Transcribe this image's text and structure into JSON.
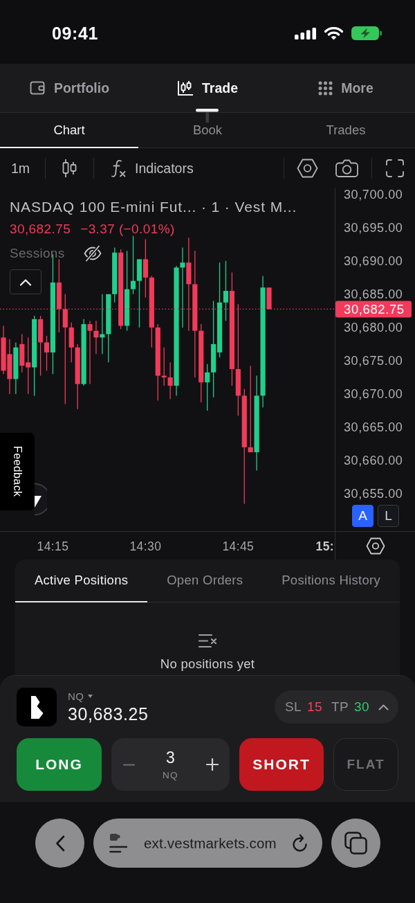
{
  "status_bar": {
    "time": "09:41"
  },
  "nav": {
    "items": [
      {
        "label": "Portfolio",
        "selected": false
      },
      {
        "label": "Trade",
        "selected": true
      },
      {
        "label": "More",
        "selected": false
      }
    ]
  },
  "chart_tabs": [
    {
      "label": "Chart",
      "selected": true
    },
    {
      "label": "Book",
      "selected": false
    },
    {
      "label": "Trades",
      "selected": false
    }
  ],
  "toolbar": {
    "interval": "1m",
    "indicators": "Indicators"
  },
  "chart": {
    "legend": {
      "title": "NASDAQ 100 E-mini Fut... · 1 · Vest M...",
      "price": "30,682.75",
      "change": "−3.37 (−0.01%)",
      "sessions": {
        "label": "Sessions",
        "visible": false
      }
    },
    "scale_buttons": [
      {
        "label": "A",
        "selected": true
      },
      {
        "label": "L",
        "selected": false
      }
    ],
    "edge_time_label": "15:",
    "chart_data": {
      "type": "candlestick",
      "ylim": [
        30649.4,
        30700.9
      ],
      "yticks": [
        {
          "value": 30700,
          "label": "30,700.00"
        },
        {
          "value": 30695,
          "label": "30,695.00"
        },
        {
          "value": 30690,
          "label": "30,690.00"
        },
        {
          "value": 30685,
          "label": "30,685.00"
        },
        {
          "value": 30680,
          "label": "30,680.00"
        },
        {
          "value": 30675,
          "label": "30,675.00"
        },
        {
          "value": 30670,
          "label": "30,670.00"
        },
        {
          "value": 30665,
          "label": "30,665.00"
        },
        {
          "value": 30660,
          "label": "30,660.00"
        },
        {
          "value": 30655,
          "label": "30,655.00"
        }
      ],
      "categories": [
        null,
        null,
        null,
        null,
        null,
        null,
        null,
        null,
        "14:15",
        null,
        null,
        null,
        null,
        null,
        null,
        null,
        null,
        null,
        null,
        null,
        null,
        null,
        null,
        "14:30",
        null,
        null,
        null,
        null,
        null,
        null,
        null,
        null,
        null,
        null,
        null,
        null,
        null,
        null,
        "14:45",
        null,
        null,
        null,
        null,
        null,
        null,
        null,
        null,
        null,
        null,
        null,
        null,
        null,
        null,
        null
      ],
      "series": [
        {
          "ohlc": [
            [
              30678.5,
              30680.25,
              30673,
              30673.5
            ],
            [
              30676,
              30678.25,
              30670,
              30672.25
            ],
            [
              30672.25,
              30677.75,
              30670,
              30677
            ],
            [
              30677.5,
              30679,
              30673.25,
              30674.25
            ],
            [
              30674.75,
              30678.5,
              30670,
              30674
            ],
            [
              30674,
              30681.75,
              30669.75,
              30681.25
            ],
            [
              30681.25,
              30681.75,
              30672.75,
              30677.75
            ],
            [
              30677.75,
              30678.75,
              30673.5,
              30676.25
            ],
            [
              30676.25,
              30691,
              30673,
              30686.75
            ],
            [
              30686.75,
              30690.25,
              30679.25,
              30682.75
            ],
            [
              30682.75,
              30685,
              30668.5,
              30680
            ],
            [
              30680,
              30680.75,
              30674.75,
              30677
            ],
            [
              30677,
              30677.5,
              30667.75,
              30671.5
            ],
            [
              30671.5,
              30681.25,
              30671.25,
              30680.5
            ],
            [
              30680.5,
              30681,
              30671.5,
              30679.5
            ],
            [
              30679.5,
              30681,
              30676,
              30678.5
            ],
            [
              30678.5,
              30685,
              30676,
              30679
            ],
            [
              30679,
              30685,
              30674.75,
              30685
            ],
            [
              30685,
              30692,
              30683.75,
              30691.25
            ],
            [
              30691.25,
              30691.75,
              30679.75,
              30680.25
            ],
            [
              30680.25,
              30691.5,
              30679.5,
              30685.75
            ],
            [
              30685.75,
              30693.75,
              30685,
              30687
            ],
            [
              30687,
              30690.25,
              30680,
              30690.25
            ],
            [
              30690.25,
              30693.25,
              30684.5,
              30687.5
            ],
            [
              30687.5,
              30687.75,
              30677,
              30680
            ],
            [
              30680,
              30680.5,
              30669,
              30672.75
            ],
            [
              30672.75,
              30677,
              30671.25,
              30672.5
            ],
            [
              30672.5,
              30674.75,
              30669.25,
              30671.25
            ],
            [
              30671.25,
              30689.25,
              30669.75,
              30689
            ],
            [
              30689,
              30692,
              30680,
              30689.75
            ],
            [
              30689.75,
              30693.5,
              30679.5,
              30686.5
            ],
            [
              30686.5,
              30691.5,
              30672.5,
              30679.5
            ],
            [
              30679.5,
              30680.5,
              30668.75,
              30671.75
            ],
            [
              30671.75,
              30674.5,
              30667.5,
              30673.25
            ],
            [
              30673.25,
              30684,
              30669.5,
              30677.5
            ],
            [
              30676.25,
              30689.75,
              30675.5,
              30683.75
            ],
            [
              30683.75,
              30690,
              30681,
              30685.5
            ],
            [
              30685.5,
              30688.25,
              30671.25,
              30673.75
            ],
            [
              30673.75,
              30683.5,
              30666.75,
              30669.75
            ],
            [
              30669.75,
              30670.75,
              30653.5,
              30662
            ],
            [
              30662,
              30674.25,
              30661.25,
              30661.25
            ],
            [
              30661.25,
              30672.75,
              30658.5,
              30669.75
            ],
            [
              30669.75,
              30687.75,
              30668,
              30686
            ],
            [
              30686,
              30686,
              30682.75,
              30682.75
            ],
            null,
            null,
            null,
            null,
            null,
            null,
            null,
            null,
            null,
            null
          ]
        }
      ],
      "ref_lines": [
        {
          "axis": "y",
          "value": 30682.75,
          "label": "30,682.75"
        }
      ]
    }
  },
  "feedback": {
    "label": "Feedback"
  },
  "positions": {
    "tabs": [
      {
        "label": "Active Positions",
        "selected": true
      },
      {
        "label": "Open Orders",
        "selected": false
      },
      {
        "label": "Positions History",
        "selected": false
      }
    ],
    "empty_text": "No positions yet"
  },
  "order_panel": {
    "symbol": "NQ",
    "price": "30,683.25",
    "stop_loss": {
      "label": "SL",
      "value": "15"
    },
    "take_profit": {
      "label": "TP",
      "value": "30"
    },
    "long": "LONG",
    "quantity": "3",
    "quantity_unit": "NQ",
    "short": "SHORT",
    "flat": "FLAT"
  },
  "browser": {
    "url": "ext.vestmarkets.com"
  }
}
